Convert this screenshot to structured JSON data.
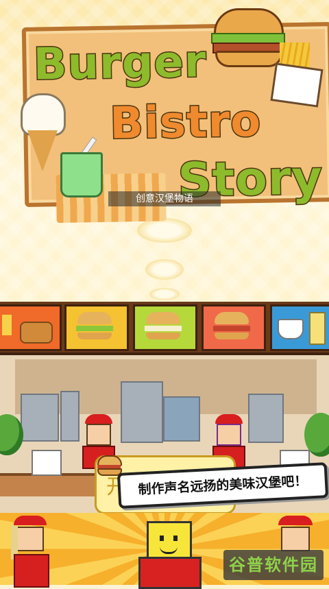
{
  "title": {
    "logo_line_1": "Burger",
    "logo_line_2": "Bistro",
    "logo_line_3": "Story",
    "subtitle": "创意汉堡物语"
  },
  "menu_board": {
    "items": [
      "fries",
      "nuggets",
      "chicken-burger",
      "egg-burger",
      "classic-burger",
      "salad-and-drink"
    ]
  },
  "speech_bubble": {
    "back_text": "开始游",
    "banner_text": "制作声名远扬的美味汉堡吧！"
  },
  "watermark": {
    "text": "谷普软件园"
  },
  "colors": {
    "logo_green": "#8dbb2c",
    "logo_orange": "#f08a2e",
    "uniform_red": "#d62020",
    "menu_wood": "#6a3a1b"
  }
}
